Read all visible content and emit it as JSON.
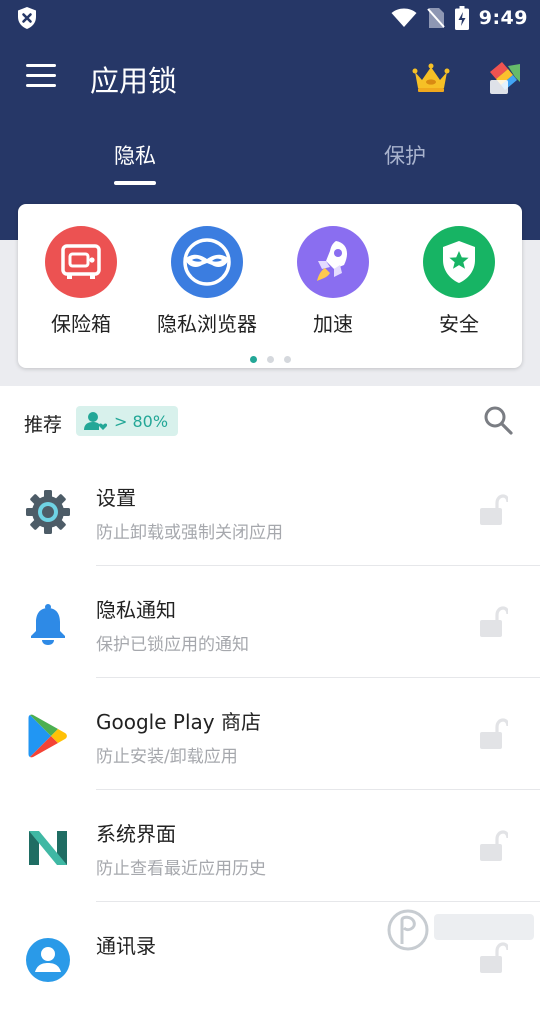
{
  "status_bar": {
    "time": "9:49"
  },
  "app_bar": {
    "title": "应用锁",
    "menu_icon": "hamburger-menu-icon",
    "vip_icon": "crown-icon",
    "theme_icon": "theme-icon"
  },
  "tabs": [
    {
      "label": "隐私",
      "active": true
    },
    {
      "label": "保护",
      "active": false
    }
  ],
  "features": [
    {
      "label": "保险箱",
      "icon": "safe-icon",
      "color": "#ec5252"
    },
    {
      "label": "隐私浏览器",
      "icon": "mask-icon",
      "color": "#3b7de0"
    },
    {
      "label": "加速",
      "icon": "rocket-icon",
      "color": "#8a6ef0"
    },
    {
      "label": "安全",
      "icon": "shield-star-icon",
      "color": "#17b464"
    }
  ],
  "pager": {
    "pages": 3,
    "active": 0
  },
  "recommend": {
    "label": "推荐",
    "badge": "> 80%"
  },
  "apps": [
    {
      "title": "设置",
      "desc": "防止卸载或强制关闭应用",
      "icon": "gear-icon",
      "locked": false
    },
    {
      "title": "隐私通知",
      "desc": "保护已锁应用的通知",
      "icon": "bell-icon",
      "locked": false
    },
    {
      "title": "Google Play 商店",
      "desc": "防止安装/卸载应用",
      "icon": "google-play-icon",
      "locked": false
    },
    {
      "title": "系统界面",
      "desc": "防止查看最近应用历史",
      "icon": "nova-n-icon",
      "locked": false
    },
    {
      "title": "通讯录",
      "desc": "",
      "icon": "contacts-icon",
      "locked": false
    }
  ],
  "colors": {
    "header": "#263767",
    "accent": "#23a797",
    "band": "#ebecf0"
  }
}
